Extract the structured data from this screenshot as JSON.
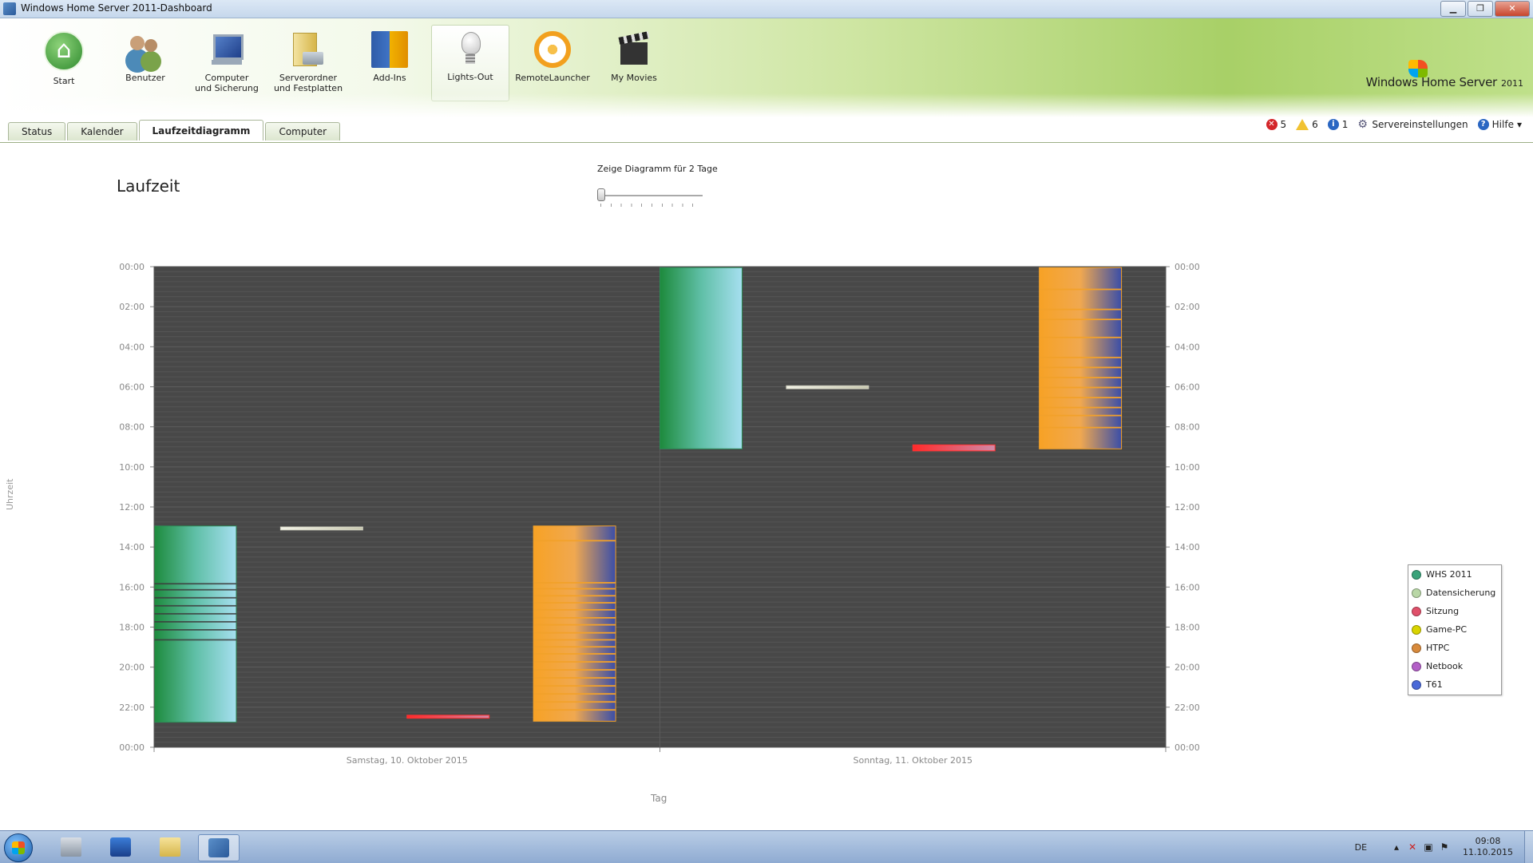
{
  "window": {
    "title": "Windows Home Server 2011-Dashboard",
    "btn_min": "▁",
    "btn_max": "❐",
    "btn_close": "✕"
  },
  "ribbon": {
    "items": [
      {
        "label": "Start",
        "icon": "home-icon"
      },
      {
        "label": "Benutzer",
        "icon": "users-icon"
      },
      {
        "label": "Computer\nund Sicherung",
        "icon": "computer-icon"
      },
      {
        "label": "Serverordner\nund Festplatten",
        "icon": "folder-icon"
      },
      {
        "label": "Add-Ins",
        "icon": "addin-icon"
      },
      {
        "label": "Lights-Out",
        "icon": "lightbulb-icon"
      },
      {
        "label": "RemoteLauncher",
        "icon": "remote-launcher-icon"
      },
      {
        "label": "My Movies",
        "icon": "movie-clapper-icon"
      }
    ],
    "active_index": 5,
    "logo_text": "Windows Home Server",
    "logo_year": "2011"
  },
  "tabs": [
    {
      "label": "Status"
    },
    {
      "label": "Kalender"
    },
    {
      "label": "Laufzeitdiagramm"
    },
    {
      "label": "Computer"
    }
  ],
  "toolbar": {
    "errors": "5",
    "warnings": "6",
    "info": "1",
    "settings_label": "Servereinstellungen",
    "help_label": "Hilfe",
    "help_arrow": "▾"
  },
  "page": {
    "title": "Laufzeit",
    "slider_label": "Zeige Diagramm für 2 Tage",
    "slider_value": 2
  },
  "chart_data": {
    "type": "bar",
    "title": "",
    "ylabel": "Uhrzeit",
    "xlabel": "Tag",
    "y_ticks": [
      "00:00",
      "02:00",
      "04:00",
      "06:00",
      "08:00",
      "10:00",
      "12:00",
      "14:00",
      "16:00",
      "18:00",
      "20:00",
      "22:00",
      "00:00"
    ],
    "ylim_hours": [
      0,
      24
    ],
    "categories": [
      "Samstag, 10. Oktober 2015",
      "Sonntag, 11. Oktober 2015"
    ],
    "series_order": [
      "WHS 2011",
      "Datensicherung",
      "Sitzung",
      "HTPC"
    ],
    "bars": [
      {
        "day": 0,
        "series": "WHS 2011",
        "start": 12.95,
        "end": 22.75,
        "gaps": [
          15.8,
          16.1,
          16.5,
          16.9,
          17.3,
          17.7,
          18.1,
          18.6
        ]
      },
      {
        "day": 0,
        "series": "Datensicherung",
        "start": 13.0,
        "end": 13.15,
        "gaps": []
      },
      {
        "day": 0,
        "series": "Sitzung",
        "start": 22.4,
        "end": 22.55,
        "gaps": []
      },
      {
        "day": 0,
        "series": "HTPC",
        "start": 12.95,
        "end": 22.7,
        "gaps": [
          13.65,
          15.75,
          16.05,
          16.4,
          16.75,
          17.1,
          17.5,
          17.85,
          18.25,
          18.6,
          18.95,
          19.3,
          19.7,
          20.1,
          20.5,
          20.9,
          21.3,
          21.7,
          22.1
        ]
      },
      {
        "day": 1,
        "series": "WHS 2011",
        "start": 0.05,
        "end": 9.1,
        "gaps": []
      },
      {
        "day": 1,
        "series": "Datensicherung",
        "start": 5.95,
        "end": 6.1,
        "gaps": []
      },
      {
        "day": 1,
        "series": "Sitzung",
        "start": 8.9,
        "end": 9.2,
        "gaps": []
      },
      {
        "day": 1,
        "series": "HTPC",
        "start": 0.05,
        "end": 9.1,
        "gaps": [
          1.1,
          2.1,
          2.6,
          3.5,
          4.5,
          5.0,
          5.5,
          6.0,
          6.5,
          7.0,
          7.4,
          8.0
        ]
      }
    ],
    "legend": [
      {
        "name": "WHS 2011",
        "color": "#3aa37a"
      },
      {
        "name": "Datensicherung",
        "color": "#b9d7a6"
      },
      {
        "name": "Sitzung",
        "color": "#e0506a"
      },
      {
        "name": "Game-PC",
        "color": "#d9d400"
      },
      {
        "name": "HTPC",
        "color": "#d88a3c"
      },
      {
        "name": "Netbook",
        "color": "#b35fc7"
      },
      {
        "name": "T61",
        "color": "#4a69d8"
      }
    ],
    "legend_position": "right",
    "grid": true
  },
  "taskbar": {
    "language": "DE",
    "time": "09:08",
    "date": "11.10.2015"
  }
}
